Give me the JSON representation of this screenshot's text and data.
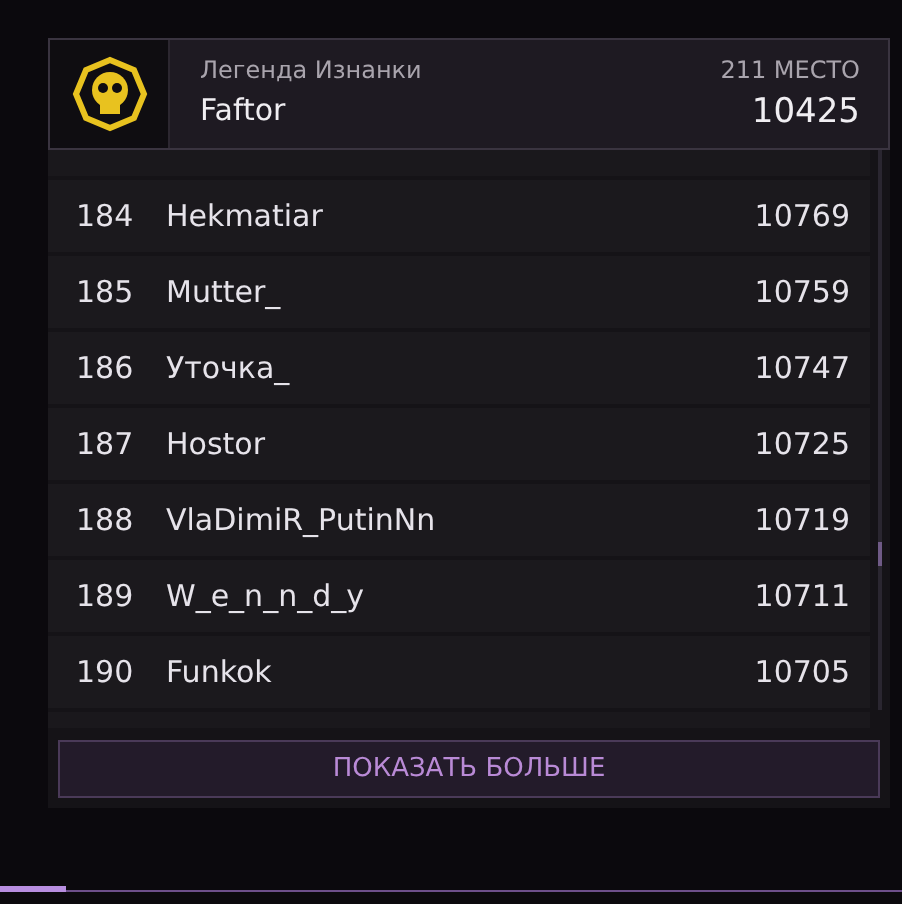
{
  "player": {
    "title": "Легенда Изнанки",
    "name": "Faftor",
    "place": "211 МЕСТО",
    "score": "10425"
  },
  "rows": [
    {
      "rank": "184",
      "name": "Hekmatiar",
      "score": "10769"
    },
    {
      "rank": "185",
      "name": "Mutter_",
      "score": "10759"
    },
    {
      "rank": "186",
      "name": "Уточка_",
      "score": "10747"
    },
    {
      "rank": "187",
      "name": "Hostor",
      "score": "10725"
    },
    {
      "rank": "188",
      "name": "VlaDimiR_PutinNn",
      "score": "10719"
    },
    {
      "rank": "189",
      "name": "W_e_n_n_d_y",
      "score": "10711"
    },
    {
      "rank": "190",
      "name": "Funkok",
      "score": "10705"
    }
  ],
  "more_button": "ПОКАЗАТЬ БОЛЬШЕ",
  "progress": {
    "level": 0.073
  }
}
